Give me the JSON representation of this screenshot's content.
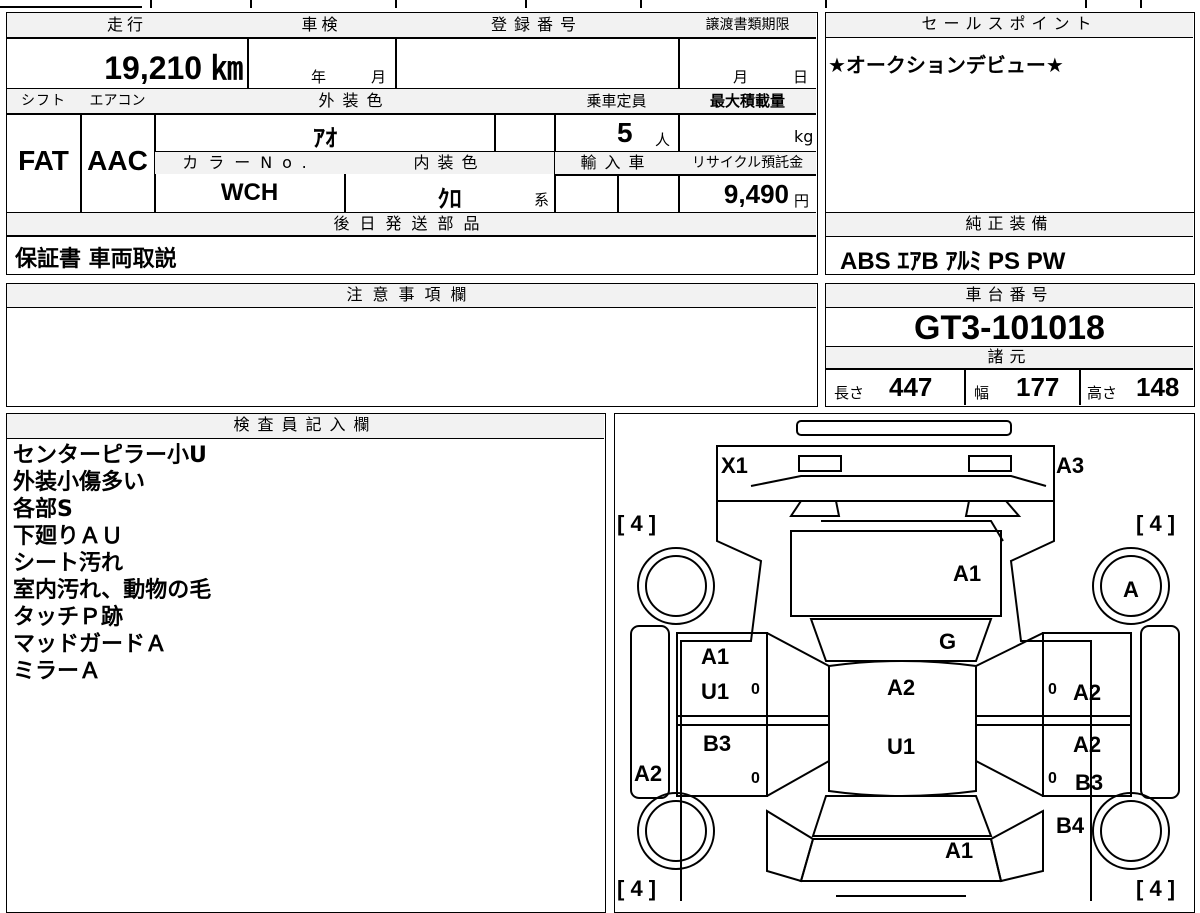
{
  "spec_table": {
    "mileage": {
      "label": "走行",
      "value": "19,210 ㎞"
    },
    "inspection": {
      "label": "車検",
      "year_unit": "年",
      "month_unit": "月"
    },
    "registration": {
      "label": "登録番号",
      "value": ""
    },
    "transfer_deadline": {
      "label": "譲渡書類期限",
      "month_unit": "月",
      "day_unit": "日"
    },
    "shift": {
      "label": "シフト",
      "value": "FAT"
    },
    "aircon": {
      "label": "エアコン",
      "value": "AAC"
    },
    "exterior_color": {
      "label": "外装色",
      "value": "ｱｵ"
    },
    "capacity": {
      "label": "乗車定員",
      "value": "5",
      "unit": "人"
    },
    "max_load": {
      "label": "最大積載量",
      "unit": "kg"
    },
    "color_no": {
      "label": "カラーNo.",
      "value": "WCH"
    },
    "interior_color": {
      "label": "内装色",
      "value": "ｸﾛ",
      "unit": "系"
    },
    "imported": {
      "label": "輸入車"
    },
    "recycle_fee": {
      "label": "リサイクル預託金",
      "value": "9,490",
      "unit": "円"
    },
    "later_parts": {
      "label": "後日発送部品",
      "value": "保証書 車両取説"
    }
  },
  "sales_point": {
    "label": "セールスポイント",
    "value": "★オークションデビュー★"
  },
  "genuine_equipment": {
    "label": "純正装備",
    "value": "ABS ｴｱB ｱﾙﾐ PS PW"
  },
  "notes": {
    "label": "注意事項欄"
  },
  "chassis": {
    "label": "車台番号",
    "value": "GT3-101018"
  },
  "dimensions": {
    "label": "諸元",
    "length_label": "長さ",
    "length": "447",
    "width_label": "幅",
    "width": "177",
    "height_label": "高さ",
    "height": "148"
  },
  "inspector": {
    "label": "検査員記入欄",
    "lines": [
      "センターピラー小U",
      "外装小傷多い",
      "各部S",
      "下廻りＡＵ",
      "シート汚れ",
      "室内汚れ、動物の毛",
      "タッチＰ跡",
      "マッドガードＡ",
      "ミラーＡ"
    ]
  },
  "damage_map": {
    "tread_front_left": "[ 4 ]",
    "tread_front_right": "[ 4 ]",
    "tread_rear_left": "[ 4 ]",
    "tread_rear_right": "[ 4 ]",
    "x1": "X1",
    "a3_top": "A3",
    "hood": "A1",
    "front_wheel_right": "A",
    "glass": "G",
    "left_front_door_1": "A1",
    "left_front_door_2": "U1",
    "left_rear_door": "B3",
    "left_rear_fender": "A2",
    "roof": "A2",
    "roof_rear": "U1",
    "right_front_door": "A2",
    "right_rear_door_1": "A2",
    "right_rear_door_2": "B3",
    "right_rear_fender": "B4",
    "trunk": "A1",
    "zero": "0"
  }
}
